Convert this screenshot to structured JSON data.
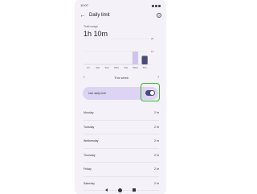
{
  "status": {
    "time": "10:07"
  },
  "header": {
    "title": "Daily limit"
  },
  "usage": {
    "label": "Total usage",
    "value": "1h 10m"
  },
  "chart_data": {
    "type": "bar",
    "categories": [
      "Fri",
      "Sat",
      "Sun",
      "Mon",
      "Tue",
      "Wed",
      "Thu"
    ],
    "values": [
      0,
      0,
      0,
      0,
      0,
      60,
      40
    ],
    "y_tick_labels": [
      "1h",
      "2h"
    ],
    "ylim": [
      0,
      120
    ],
    "colors": [
      "#cfc5ea",
      "#4a4b77"
    ]
  },
  "week": {
    "label": "This week"
  },
  "limit": {
    "label": "Use daily limit",
    "enabled": true
  },
  "days": [
    {
      "name": "Monday",
      "limit": "2 hr"
    },
    {
      "name": "Tuesday",
      "limit": "2 hr"
    },
    {
      "name": "Wednesday",
      "limit": "2 hr"
    },
    {
      "name": "Thursday",
      "limit": "2 hr"
    },
    {
      "name": "Friday",
      "limit": "2 hr"
    },
    {
      "name": "Saturday",
      "limit": "2 hr"
    }
  ]
}
